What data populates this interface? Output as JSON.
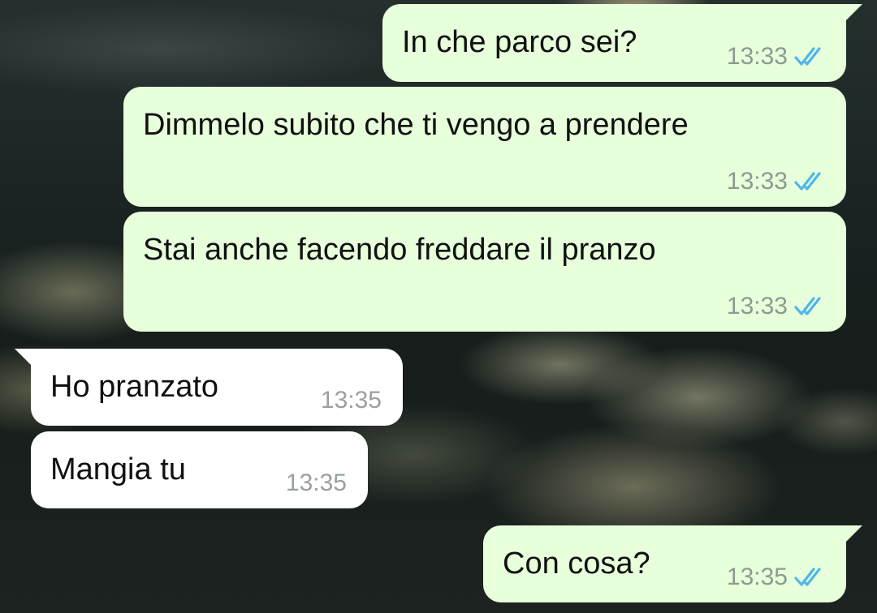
{
  "colors": {
    "outgoing_bubble": "#e7ffdb",
    "incoming_bubble": "#ffffff",
    "read_ticks": "#4fb6ec",
    "timestamp": "#8d9a90"
  },
  "messages": [
    {
      "direction": "outgoing",
      "text": "In che parco sei?",
      "time": "13:33",
      "status_icon": "double-check-read-icon"
    },
    {
      "direction": "outgoing",
      "text": "Dimmelo subito che ti vengo a prendere",
      "time": "13:33",
      "status_icon": "double-check-read-icon"
    },
    {
      "direction": "outgoing",
      "text": "Stai anche facendo freddare il pranzo",
      "time": "13:33",
      "status_icon": "double-check-read-icon"
    },
    {
      "direction": "incoming",
      "text": "Ho pranzato",
      "time": "13:35"
    },
    {
      "direction": "incoming",
      "text": "Mangia tu",
      "time": "13:35"
    },
    {
      "direction": "outgoing",
      "text": "Con cosa?",
      "time": "13:35",
      "status_icon": "double-check-read-icon"
    }
  ]
}
